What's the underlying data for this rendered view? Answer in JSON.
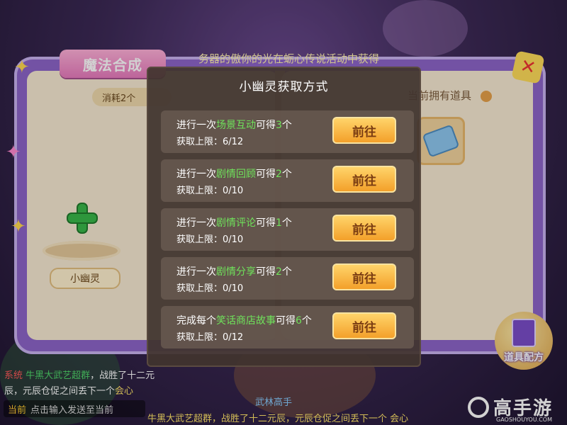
{
  "book": {
    "title": "魔法合成",
    "top_text": "务器的傲你的光在蛎心传说活动中获得",
    "consume": "消耗2个",
    "owned_label": "当前拥有道具",
    "ghost_label": "小幽灵",
    "recipe_button": "道具配方"
  },
  "modal": {
    "title": "小幽灵获取方式",
    "rows": [
      {
        "prefix": "进行一次",
        "activity": "场景互动",
        "mid": "可得",
        "count": "3",
        "suffix": "个",
        "limit": "获取上限：6/12",
        "button": "前往"
      },
      {
        "prefix": "进行一次",
        "activity": "剧情回顾",
        "mid": "可得",
        "count": "2",
        "suffix": "个",
        "limit": "获取上限：0/10",
        "button": "前往"
      },
      {
        "prefix": "进行一次",
        "activity": "剧情评论",
        "mid": "可得",
        "count": "1",
        "suffix": "个",
        "limit": "获取上限：0/10",
        "button": "前往"
      },
      {
        "prefix": "进行一次",
        "activity": "剧情分享",
        "mid": "可得",
        "count": "2",
        "suffix": "个",
        "limit": "获取上限：0/10",
        "button": "前往"
      },
      {
        "prefix": "完成每个",
        "activity": "笑话商店故事",
        "mid": "可得",
        "count": "6",
        "suffix": "个",
        "limit": "获取上限：0/12",
        "button": "前往"
      }
    ]
  },
  "chat": {
    "system_tag": "系统",
    "line1_name": "牛黑大武艺超群",
    "line1_rest": "，战胜了十二元",
    "line2": "辰，元辰仓促之间丢下一个",
    "line2_hl": "会心",
    "input_channel": "当前",
    "input_placeholder": "点击输入发送至当前",
    "ticker": "牛黑大武艺超群，战胜了十二元辰，元辰仓促之间丢下一个 会心",
    "bottom_name": "武林高手"
  },
  "watermark": {
    "brand": "高手游",
    "url": "GAOSHOUYOU.COM"
  },
  "colors": {
    "modal_bg": "#41342e",
    "accent_green": "#6fe35b",
    "button_gold": "#f3a02a",
    "book_purple": "#8d64c9"
  }
}
